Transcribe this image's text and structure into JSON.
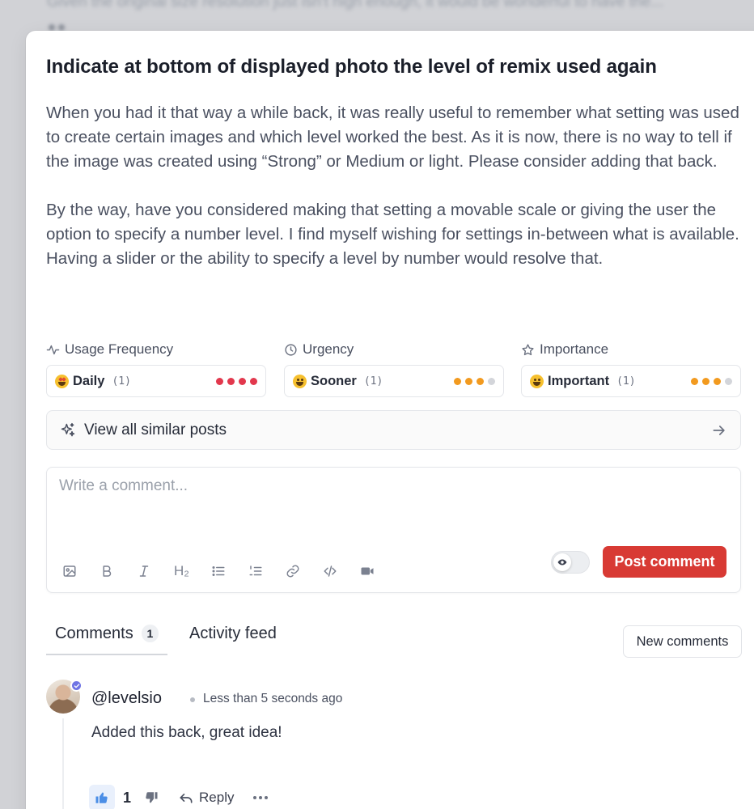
{
  "backdrop": {
    "text": "Given the original size resolution just isn't high enough, it would be wonderful to have the..."
  },
  "post": {
    "title": "Indicate at bottom of displayed photo the level of remix used again",
    "paragraphs": [
      "When you had it that way a while back, it was really useful to remember what setting was used to create certain images and which level worked the best. As it is now, there is no way to tell if the image was created using “Strong” or Medium or light. Please consider adding that back.",
      "By the way, have you considered making that setting a movable scale or giving the user the option to specify a number level. I find myself wishing for settings in-between what is available. Having a slider or the ability to specify a level by number would resolve that."
    ]
  },
  "metrics": [
    {
      "label": "Usage Frequency",
      "icon": "activity-icon",
      "emoji": "star-struck-emoji",
      "value": "Daily",
      "count": "(1)",
      "level": 4,
      "max": 4,
      "color": "#e2384d"
    },
    {
      "label": "Urgency",
      "icon": "clock-icon",
      "emoji": "smiley-emoji",
      "value": "Sooner",
      "count": "(1)",
      "level": 3,
      "max": 4,
      "color": "#f29a1f"
    },
    {
      "label": "Importance",
      "icon": "star-icon",
      "emoji": "smiley-emoji",
      "value": "Important",
      "count": "(1)",
      "level": 3,
      "max": 4,
      "color": "#f29a1f"
    }
  ],
  "similar": {
    "label": "View all similar posts"
  },
  "editor": {
    "placeholder": "Write a comment...",
    "heading_tool": "H₂",
    "toolbar_icons": [
      "image-icon",
      "bold-icon",
      "italic-icon",
      "heading-icon",
      "bullet-list-icon",
      "numbered-list-icon",
      "link-icon",
      "code-icon",
      "video-icon"
    ],
    "submit_label": "Post comment",
    "accent": "#d83a34"
  },
  "tabs": {
    "comments_label": "Comments",
    "comments_count": "1",
    "activity_label": "Activity feed",
    "new_comments_label": "New comments"
  },
  "comment": {
    "author": "@levelsio",
    "time": "Less than 5 seconds ago",
    "text": "Added this back, great idea!",
    "likes": "1",
    "reply_label": "Reply",
    "verified_color": "#6f74e4"
  }
}
